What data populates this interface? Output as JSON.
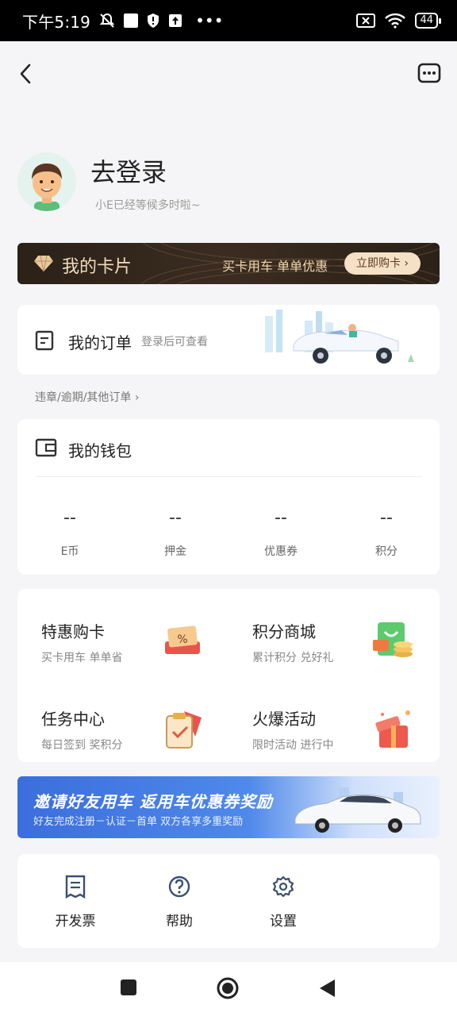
{
  "status_bar": {
    "time": "下午5:19",
    "battery": "44"
  },
  "nav": {
    "back_icon": "chevron-left-icon",
    "message_icon": "chat-bubble-icon"
  },
  "profile": {
    "title": "去登录",
    "subtitle": "小E已经等候多时啦~"
  },
  "card_banner": {
    "title": "我的卡片",
    "promo": "买卡用车 单单优惠",
    "button": "立即购卡 ›"
  },
  "order": {
    "title": "我的订单",
    "hint": "登录后可查看"
  },
  "other_orders": "违章/逾期/其他订单 ›",
  "wallet": {
    "title": "我的钱包",
    "items": [
      {
        "value": "--",
        "label": "E币"
      },
      {
        "value": "--",
        "label": "押金"
      },
      {
        "value": "--",
        "label": "优惠券"
      },
      {
        "value": "--",
        "label": "积分"
      }
    ]
  },
  "services": [
    {
      "title": "特惠购卡",
      "subtitle": "买卡用车 单单省",
      "icon": "discount-ticket-icon"
    },
    {
      "title": "积分商城",
      "subtitle": "累计积分 兑好礼",
      "icon": "shopping-bag-coins-icon"
    },
    {
      "title": "任务中心",
      "subtitle": "每日签到 奖积分",
      "icon": "task-clipboard-icon"
    },
    {
      "title": "火爆活动",
      "subtitle": "限时活动 进行中",
      "icon": "gift-box-icon"
    }
  ],
  "invite_banner": {
    "title": "邀请好友用车 返用车优惠券奖励",
    "subtitle": "好友完成注册－认证－首单 双方各享多重奖励"
  },
  "bottom_links": [
    {
      "label": "开发票",
      "icon": "invoice-icon"
    },
    {
      "label": "帮助",
      "icon": "question-icon"
    },
    {
      "label": "设置",
      "icon": "gear-icon"
    }
  ],
  "colors": {
    "card_banner_bg": "#2b2118",
    "card_banner_text": "#f2dcbc",
    "invite_blue": "#3b6edc",
    "page_bg": "#f5f5f7"
  }
}
